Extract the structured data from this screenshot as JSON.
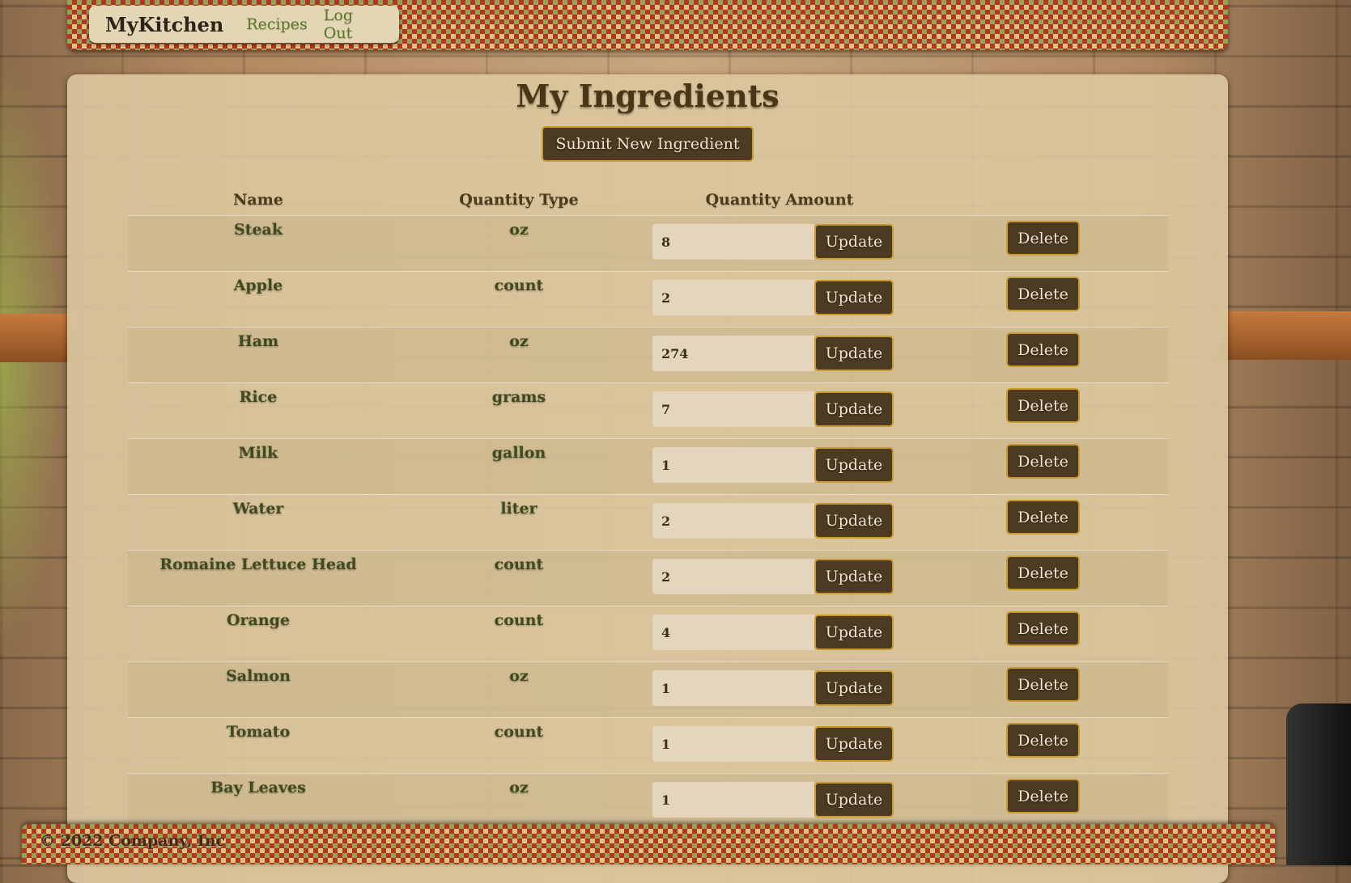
{
  "navbar": {
    "brand": "MyKitchen",
    "links": [
      {
        "label": "Recipes"
      },
      {
        "label": "Log Out"
      }
    ]
  },
  "page": {
    "title": "My Ingredients",
    "submit_label": "Submit New Ingredient"
  },
  "table": {
    "headers": {
      "name": "Name",
      "quantity_type": "Quantity Type",
      "quantity_amount": "Quantity Amount"
    },
    "update_label": "Update",
    "delete_label": "Delete",
    "rows": [
      {
        "name": "Steak",
        "type": "oz",
        "amount": "8"
      },
      {
        "name": "Apple",
        "type": "count",
        "amount": "2"
      },
      {
        "name": "Ham",
        "type": "oz",
        "amount": "274"
      },
      {
        "name": "Rice",
        "type": "grams",
        "amount": "7"
      },
      {
        "name": "Milk",
        "type": "gallon",
        "amount": "1"
      },
      {
        "name": "Water",
        "type": "liter",
        "amount": "2"
      },
      {
        "name": "Romaine Lettuce Head",
        "type": "count",
        "amount": "2"
      },
      {
        "name": "Orange",
        "type": "count",
        "amount": "4"
      },
      {
        "name": "Salmon",
        "type": "oz",
        "amount": "1"
      },
      {
        "name": "Tomato",
        "type": "count",
        "amount": "1"
      },
      {
        "name": "Bay Leaves",
        "type": "oz",
        "amount": "1"
      }
    ]
  },
  "footer": {
    "text": "© 2022 Company, Inc"
  },
  "colors": {
    "button_bg": "#4d3a22",
    "button_border": "#c99a2c",
    "checker_red": "#b8322a",
    "checker_yellow": "#d8c77a"
  }
}
